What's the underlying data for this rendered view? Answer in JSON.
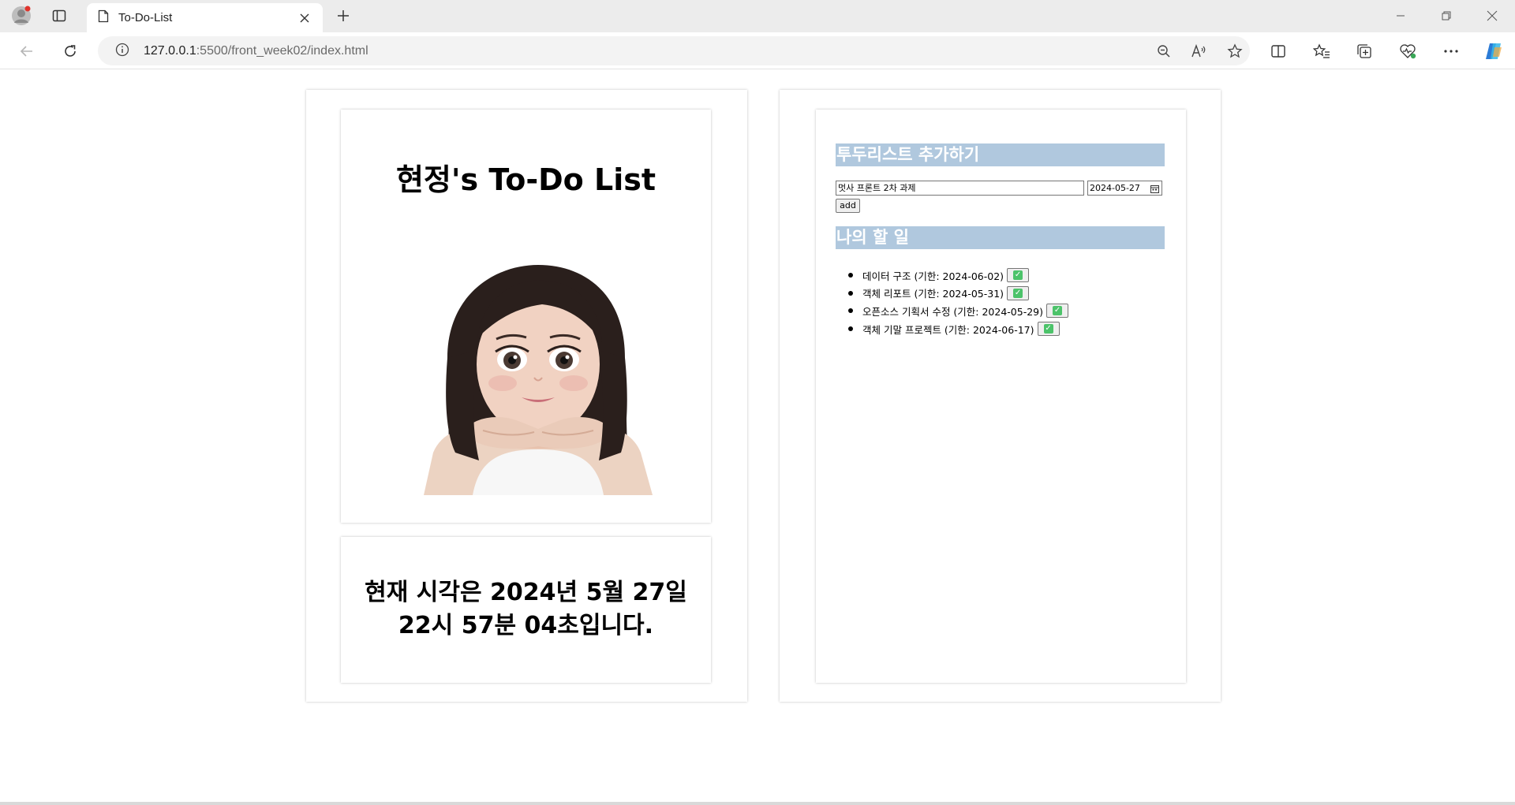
{
  "browser": {
    "tab_title": "To-Do-List",
    "url_host": "127.0.0.1",
    "url_path": ":5500/front_week02/index.html"
  },
  "profile": {
    "title": "현정's To-Do List",
    "avatar_alt": "memoji avatar"
  },
  "clock": {
    "line1": "현재 시각은 2024년 5월 27일",
    "line2": "22시 57분 04초입니다."
  },
  "add_section": {
    "heading": "투두리스트 추가하기",
    "todo_value": "멋사 프론트 2차 과제",
    "date_value": "2024-05-27",
    "add_label": "add"
  },
  "my_section": {
    "heading": "나의 할 일",
    "items": [
      {
        "text": "데이터 구조 (기한: 2024-06-02)"
      },
      {
        "text": "객체 리포트 (기한: 2024-05-31)"
      },
      {
        "text": "오픈소스 기획서 수정 (기한: 2024-05-29)"
      },
      {
        "text": "객체 기말 프로젝트 (기한: 2024-06-17)"
      }
    ]
  },
  "colors": {
    "section_header": "#b0c8de",
    "check": "#4cc36a"
  }
}
